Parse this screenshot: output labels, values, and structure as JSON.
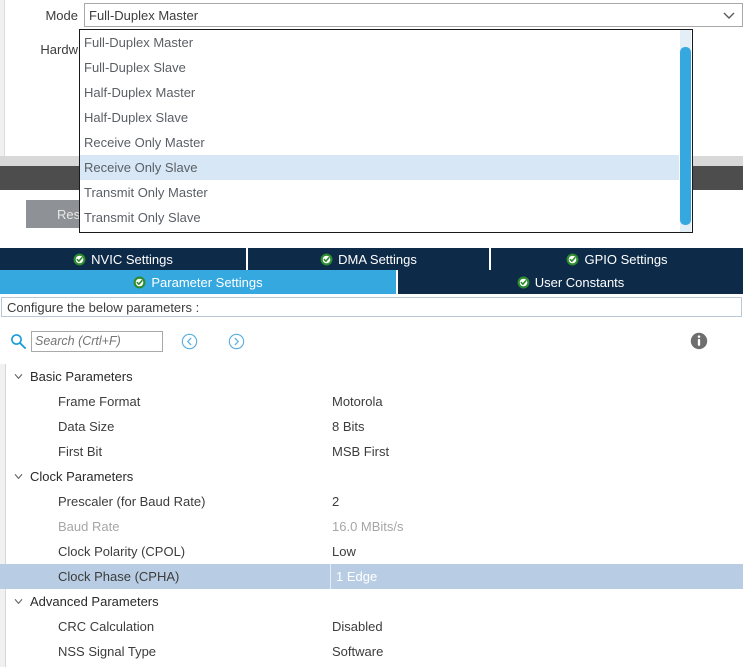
{
  "form": {
    "mode": {
      "label": "Mode",
      "value": "Full-Duplex Master",
      "arrow_icon": "chevron-down-icon"
    },
    "hardware": {
      "label": "Hardw"
    }
  },
  "dropdown": {
    "selected_index": 5,
    "items": [
      "Full-Duplex Master",
      "Full-Duplex Slave",
      "Half-Duplex Master",
      "Half-Duplex Slave",
      "Receive Only Master",
      "Receive Only Slave",
      "Transmit Only Master",
      "Transmit Only Slave"
    ]
  },
  "reset": {
    "label": "Reset"
  },
  "tabs_row1": [
    {
      "label": "NVIC Settings",
      "icon": "green-check-icon",
      "active": false
    },
    {
      "label": "DMA Settings",
      "icon": "green-check-icon",
      "active": false
    },
    {
      "label": "GPIO Settings",
      "icon": "green-check-icon",
      "active": false
    }
  ],
  "tabs_row2": [
    {
      "label": "Parameter Settings",
      "icon": "green-check-icon",
      "active": true
    },
    {
      "label": "User Constants",
      "icon": "green-check-icon",
      "active": false
    }
  ],
  "configure_bar": {
    "text": "Configure the below parameters :"
  },
  "search": {
    "placeholder": "Search (Crtl+F)",
    "value": "",
    "icon": "search-icon",
    "prev_icon": "nav-prev-icon",
    "next_icon": "nav-next-icon",
    "info_icon": "info-icon"
  },
  "parameters": [
    {
      "kind": "group",
      "label": "Basic Parameters",
      "expanded": true
    },
    {
      "kind": "param",
      "name": "Frame Format",
      "value": "Motorola",
      "dim": false,
      "selected": false
    },
    {
      "kind": "param",
      "name": "Data Size",
      "value": "8 Bits",
      "dim": false,
      "selected": false
    },
    {
      "kind": "param",
      "name": "First Bit",
      "value": "MSB First",
      "dim": false,
      "selected": false
    },
    {
      "kind": "group",
      "label": "Clock Parameters",
      "expanded": true
    },
    {
      "kind": "param",
      "name": "Prescaler (for Baud Rate)",
      "value": "2",
      "dim": false,
      "selected": false
    },
    {
      "kind": "param",
      "name": "Baud Rate",
      "value": "16.0 MBits/s",
      "dim": true,
      "selected": false
    },
    {
      "kind": "param",
      "name": "Clock Polarity (CPOL)",
      "value": "Low",
      "dim": false,
      "selected": false
    },
    {
      "kind": "param",
      "name": "Clock Phase (CPHA)",
      "value": "1 Edge",
      "dim": false,
      "selected": true
    },
    {
      "kind": "group",
      "label": "Advanced Parameters",
      "expanded": true
    },
    {
      "kind": "param",
      "name": "CRC Calculation",
      "value": "Disabled",
      "dim": false,
      "selected": false
    },
    {
      "kind": "param",
      "name": "NSS Signal Type",
      "value": "Software",
      "dim": false,
      "selected": false
    }
  ],
  "colors": {
    "tab_inactive": "#0d2b49",
    "tab_active": "#35a8e0",
    "dropdown_highlight": "#d7e7f5",
    "row_selected": "#b8cde4",
    "scrollbar_thumb": "#35a8e0",
    "check_green": "#3f9c35",
    "band_dark": "#4d4d4d",
    "reset_button": "#8e9296"
  }
}
